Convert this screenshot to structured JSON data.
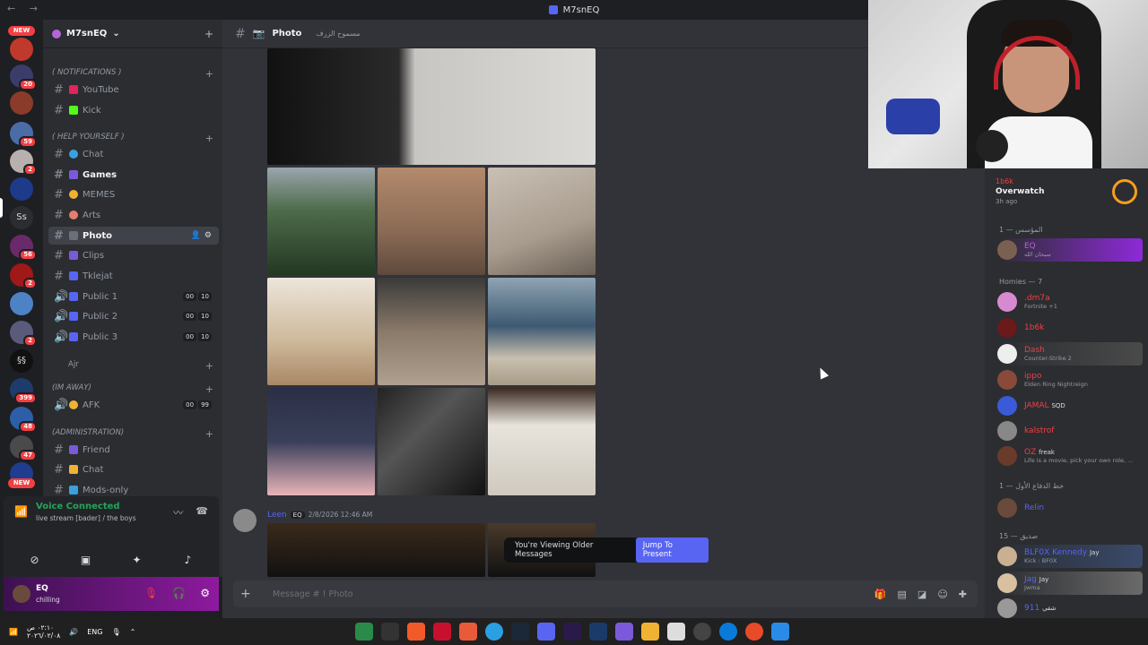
{
  "window": {
    "title": "M7snEQ"
  },
  "servers": {
    "new_label": "NEW",
    "badges": [
      "20",
      "59",
      "2",
      "56",
      "2",
      "399",
      "48",
      "47"
    ],
    "text_server": "Ss",
    "text_server2": "§§"
  },
  "server": {
    "name": "M7snEQ",
    "categories": {
      "notifications": "( NOTIFICATIONS )",
      "help": "( HELP YOURSELF )",
      "ajr": "Ajr",
      "away": "(IM AWAY)",
      "admin": "(ADMINISTRATION)"
    },
    "channels": {
      "youtube": "YouTube",
      "kick": "Kick",
      "chat": "Chat",
      "games": "Games",
      "memes": "MEMES",
      "arts": "Arts",
      "photo": "Photo",
      "clips": "Clips",
      "tklejat": "Tklejat",
      "public1": "Public 1",
      "public2": "Public 2",
      "public3": "Public 3",
      "afk": "AFK",
      "friend": "Friend",
      "chat2": "Chat",
      "mods": "Mods-only"
    },
    "voice_counts": {
      "a": "00",
      "b": "10",
      "afk_b": "99"
    }
  },
  "voice": {
    "status": "Voice Connected",
    "subtitle": "live stream [bader] / the boys"
  },
  "user": {
    "name": "EQ",
    "status": "chilling"
  },
  "header": {
    "channel": "Photo",
    "topic": "مسموح الزرف"
  },
  "message": {
    "author": "Leen",
    "tag": "EQ",
    "time": "2/8/2026 12:46 AM"
  },
  "older_bar": {
    "text": "You're Viewing Older Messages",
    "jump": "Jump To Present"
  },
  "composer": {
    "placeholder": "Message #  ! Photo"
  },
  "activity": {
    "user": "1b6k",
    "game": "Overwatch",
    "ago": "3h ago"
  },
  "member_cats": {
    "owner": "المؤسس — 1",
    "homies": "Homies — 7",
    "first": "خط الدفاع الأول — 1",
    "friends": "صديق — 15"
  },
  "members": [
    {
      "name": "EQ",
      "status": "سبحان الله",
      "color": "#b565d8"
    },
    {
      "name": ".dm7a",
      "status": "Fortnite +1",
      "color": "#f23f43"
    },
    {
      "name": "1b6k",
      "status": "",
      "color": "#f23f43"
    },
    {
      "name": "Dash",
      "status": "Counter-Strike 2",
      "color": "#f23f43"
    },
    {
      "name": "ippo",
      "status": "Elden Ring Nightreign",
      "color": "#f23f43"
    },
    {
      "name": "JAMAL",
      "status": "",
      "color": "#f23f43"
    },
    {
      "name": "kalstrof",
      "status": "",
      "color": "#f23f43"
    },
    {
      "name": "OZ",
      "status": "Life is a movie, pick your own role, ...",
      "color": "#f23f43"
    },
    {
      "name": "Relin",
      "status": "",
      "color": "#5865f2"
    },
    {
      "name": "BLF0X Kennedy",
      "status": "Kick : BF0X",
      "color": "#5865f2"
    },
    {
      "name": "Jag",
      "status": "Jwma",
      "color": "#5865f2"
    },
    {
      "name": "911",
      "status": "",
      "color": "#5865f2"
    }
  ],
  "member_tags": {
    "eq": "EQ",
    "jamal": "SQD",
    "oz": "freak",
    "blfox": "Jay",
    "jag": "Jay",
    "n911": "شقي"
  },
  "taskbar": {
    "lang": "ENG",
    "time": "٠٢:١٠ ص",
    "date": "٢٠٢٦/٠٢/٠٨"
  }
}
